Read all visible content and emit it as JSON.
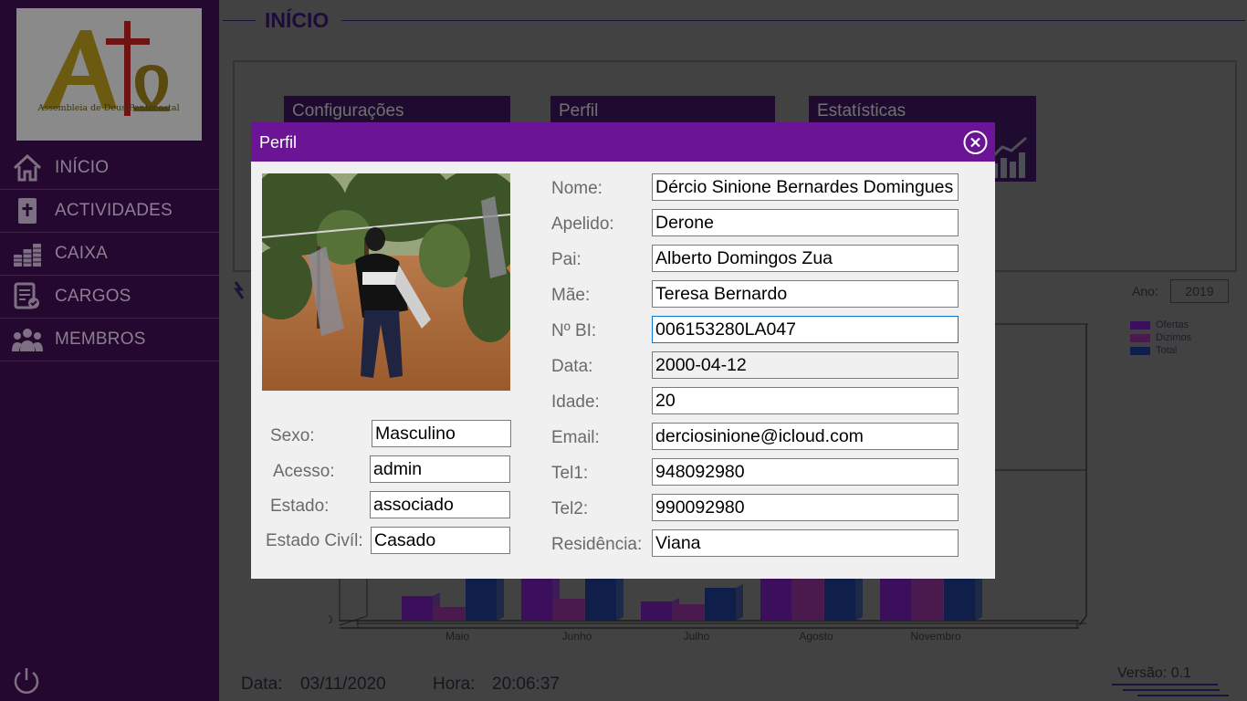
{
  "sidebar": {
    "nav": [
      {
        "id": "inicio",
        "label": "INÍCIO",
        "icon": "home-icon"
      },
      {
        "id": "actividades",
        "label": "ACTIVIDADES",
        "icon": "bible-icon"
      },
      {
        "id": "caixa",
        "label": "CAIXA",
        "icon": "coins-icon"
      },
      {
        "id": "cargos",
        "label": "CARGOS",
        "icon": "document-icon"
      },
      {
        "id": "membros",
        "label": "MEMBROS",
        "icon": "people-icon"
      }
    ],
    "logo_text": "Assembleia de Deus Pentecostal",
    "power_icon": "power-icon"
  },
  "main": {
    "title": "INÍCIO",
    "cards": [
      {
        "label": "Configurações"
      },
      {
        "label": "Perfil"
      },
      {
        "label": "Estatísticas"
      }
    ],
    "ano_label": "Ano:",
    "ano_value": "2019",
    "footer": {
      "data_label": "Data:",
      "data_value": "03/11/2020",
      "hora_label": "Hora:",
      "hora_value": "20:06:37",
      "versao": "Versão: 0.1"
    }
  },
  "chart_data": {
    "type": "bar",
    "categories": [
      "Maio",
      "Junho",
      "Julho",
      "Agosto",
      "Novembro"
    ],
    "series": [
      {
        "name": "Ofertas",
        "values": [
          45,
          100,
          35,
          100,
          100
        ]
      },
      {
        "name": "Dizimos",
        "values": [
          25,
          40,
          30,
          100,
          100
        ]
      },
      {
        "name": "Total",
        "values": [
          100,
          100,
          60,
          100,
          520
        ]
      }
    ],
    "y_tick_label": "0",
    "colors": {
      "Ofertas": "#3c0f5c",
      "Dizimos": "#4a1a4e",
      "Total": "#0f1f4a"
    },
    "legend_position": "top-right"
  },
  "modal": {
    "title": "Perfil",
    "close_icon": "close-circle-icon",
    "left_fields": [
      {
        "label": "Sexo:",
        "value": "Masculino"
      },
      {
        "label": "Acesso:",
        "value": "admin"
      },
      {
        "label": "Estado:",
        "value": "associado"
      },
      {
        "label": "Estado Civíl:",
        "value": "Casado"
      }
    ],
    "right_fields": [
      {
        "label": "Nome:",
        "value": "Dércio Sinione Bernardes Domingues"
      },
      {
        "label": "Apelido:",
        "value": "Derone"
      },
      {
        "label": "Pai:",
        "value": "Alberto Domingos Zua"
      },
      {
        "label": "Mãe:",
        "value": "Teresa Bernardo"
      },
      {
        "label": "Nº BI:",
        "value": "006153280LA047"
      },
      {
        "label": "Data:",
        "value": "2000-04-12"
      },
      {
        "label": "Idade:",
        "value": "20"
      },
      {
        "label": "Email:",
        "value": "derciosinione@icloud.com"
      },
      {
        "label": "Tel1:",
        "value": "948092980"
      },
      {
        "label": "Tel2:",
        "value": "990092980"
      },
      {
        "label": "Residência:",
        "value": "Viana"
      }
    ]
  },
  "colors": {
    "sidebar_bg": "#24082f",
    "modal_header": "#6b1596",
    "card_bg": "#1f0b2f"
  }
}
